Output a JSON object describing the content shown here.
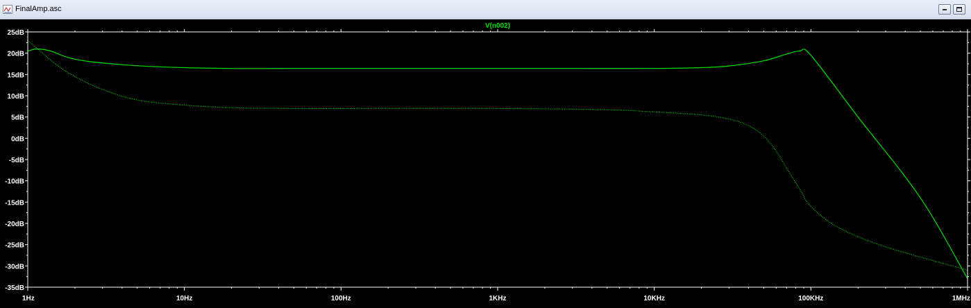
{
  "window": {
    "title": "FinalAmp.asc",
    "icon": "schematic-icon",
    "buttons": [
      {
        "name": "restore-button",
        "icon": "restore-icon"
      },
      {
        "name": "maximize-button",
        "icon": "maximize-icon"
      }
    ]
  },
  "colors": {
    "background": "#000000",
    "trace": "#00e000",
    "axis": "#ffffff"
  },
  "chart_data": {
    "type": "line",
    "title": "V(n002)",
    "xscale": "log",
    "xlim": [
      1,
      1000000
    ],
    "ylim": [
      -35,
      25
    ],
    "xticks": [
      1,
      10,
      100,
      1000,
      10000,
      100000,
      1000000
    ],
    "xtick_labels": [
      "1Hz",
      "10Hz",
      "100Hz",
      "1KHz",
      "10KHz",
      "100KHz",
      "1MHz"
    ],
    "yticks": [
      25,
      20,
      15,
      10,
      5,
      0,
      -5,
      -10,
      -15,
      -20,
      -25,
      -30,
      -35
    ],
    "ytick_labels": [
      "25dB",
      "20dB",
      "15dB",
      "10dB",
      "5dB",
      "0dB",
      "-5dB",
      "-10dB",
      "-15dB",
      "-20dB",
      "-25dB",
      "-30dB",
      "-35dB"
    ],
    "grid": false,
    "series": [
      {
        "style": "solid",
        "x": [
          1,
          1.15,
          1.4,
          1.8,
          2.5,
          4,
          6,
          10,
          20,
          50,
          100,
          300,
          1000,
          3000,
          10000,
          20000,
          30000,
          50000,
          70000,
          85000,
          100000,
          200000,
          500000,
          1000000
        ],
        "y": [
          20.5,
          21.0,
          20.5,
          19.0,
          18.0,
          17.3,
          16.9,
          16.6,
          16.4,
          16.4,
          16.4,
          16.4,
          16.4,
          16.4,
          16.4,
          16.6,
          17.0,
          18.2,
          19.8,
          20.5,
          19.5,
          5.0,
          -14.0,
          -33.0
        ]
      },
      {
        "style": "dotted",
        "x": [
          1,
          1.2,
          1.5,
          2,
          3,
          5,
          10,
          20,
          50,
          100,
          1000,
          5000,
          10000,
          20000,
          30000,
          40000,
          50000,
          60000,
          70000,
          85000,
          100000,
          150000,
          300000,
          1000000
        ],
        "y": [
          23.0,
          20.5,
          17.5,
          14.5,
          11.5,
          9.0,
          7.8,
          7.2,
          7.0,
          7.0,
          7.0,
          6.7,
          6.2,
          5.5,
          4.5,
          3.0,
          0.5,
          -3.0,
          -7.0,
          -12.0,
          -16.0,
          -21.0,
          -25.5,
          -31.0
        ]
      }
    ]
  }
}
